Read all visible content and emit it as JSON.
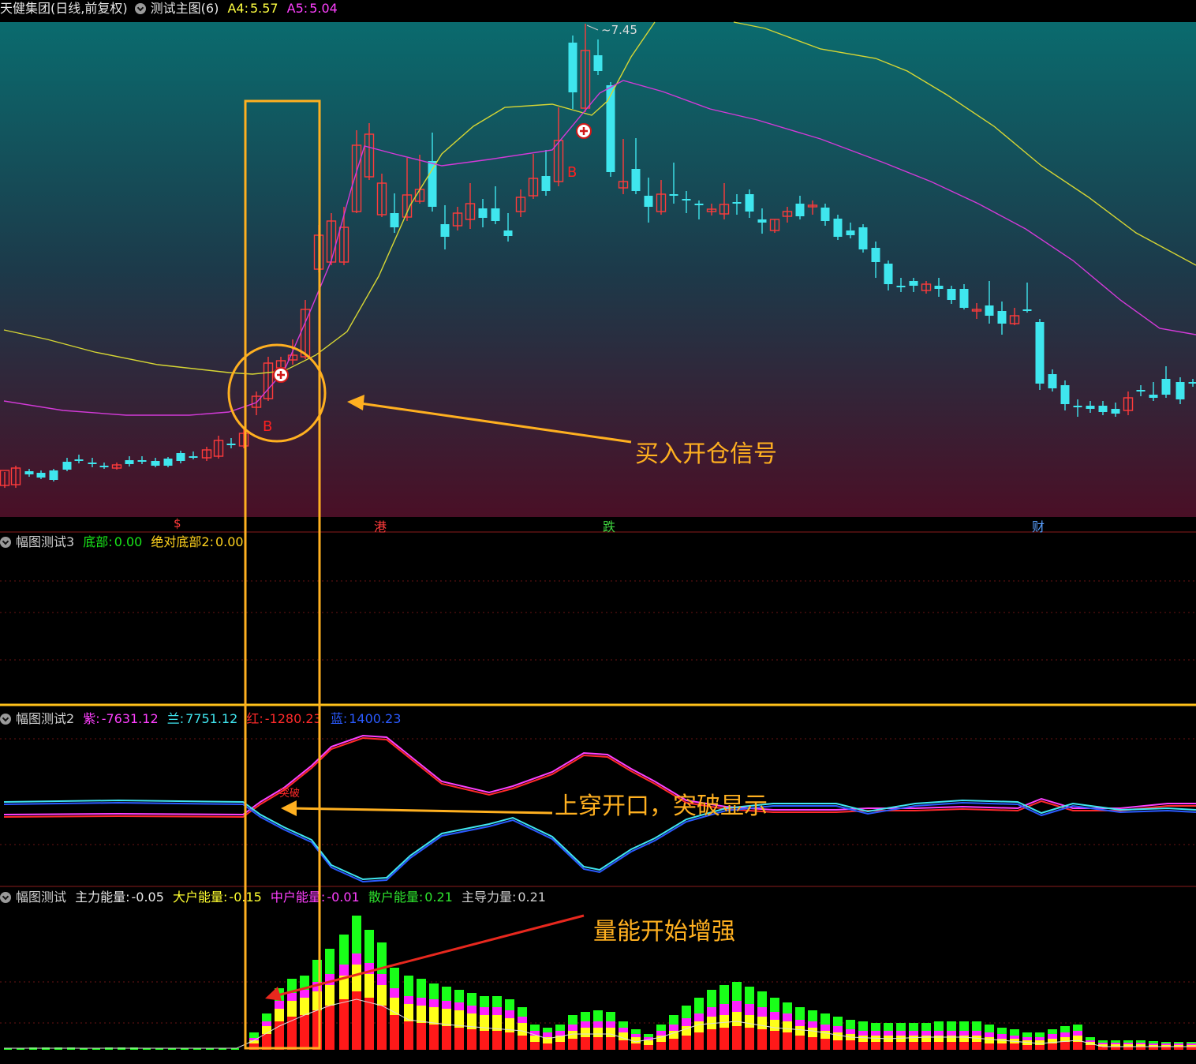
{
  "main_header": {
    "stock": "天健集团(日线,前复权)",
    "indicator": "测试主图(6)",
    "a4_label": "A4:",
    "a4_value": "5.57",
    "a5_label": "A5:",
    "a5_value": "5.04"
  },
  "peak_label": "7.45",
  "buy_marks": [
    "B",
    "B"
  ],
  "event_markers": [
    "$",
    "港",
    "跌",
    "财"
  ],
  "panel3_header": {
    "name": "幅图测试3",
    "bottom_label": "底部:",
    "bottom_value": "0.00",
    "abs_bottom_label": "绝对底部2:",
    "abs_bottom_value": "0.00"
  },
  "panel2_header": {
    "name": "幅图测试2",
    "purple_label": "紫:",
    "purple_value": "-7631.12",
    "cyan_label": "兰:",
    "cyan_value": "7751.12",
    "red_label": "红:",
    "red_value": "-1280.23",
    "blue_label": "蓝:",
    "blue_value": "1400.23"
  },
  "panel2_breakout_text": "突破",
  "panel1_header": {
    "name": "幅图测试",
    "main_label": "主力能量:",
    "main_value": "-0.05",
    "big_label": "大户能量:",
    "big_value": "-0.15",
    "mid_label": "中户能量:",
    "mid_value": "-0.01",
    "retail_label": "散户能量:",
    "retail_value": "0.21",
    "lead_label": "主导力量:",
    "lead_value": "0.21"
  },
  "annotations": {
    "buy_signal": "买入开仓信号",
    "cross_open": "上穿开口，突破显示",
    "volume_up": "量能开始增强"
  },
  "colors": {
    "up": "#ff3b3b",
    "down": "#3fe6ee",
    "yellow_line": "#d6d634",
    "magenta_line": "#d33ad8",
    "annotation": "#ffb020",
    "bar_green": "#19ff19",
    "bar_magenta": "#ff22ff",
    "bar_yellow": "#ffff19",
    "bar_red": "#ff1919"
  },
  "chart_data": [
    {
      "type": "candlestick",
      "title": "天健集团(日线,前复权)",
      "series": [
        {
          "name": "A4",
          "values": [
            5.57
          ]
        },
        {
          "name": "A5",
          "values": [
            5.04
          ]
        }
      ],
      "annotations": [
        "7.45",
        "B",
        "B"
      ]
    },
    {
      "type": "line",
      "title": "幅图测试3",
      "series": [
        {
          "name": "底部",
          "values": [
            0.0
          ]
        },
        {
          "name": "绝对底部2",
          "values": [
            0.0
          ]
        }
      ]
    },
    {
      "type": "line",
      "title": "幅图测试2",
      "series": [
        {
          "name": "紫",
          "values": [
            -7631.12
          ]
        },
        {
          "name": "兰",
          "values": [
            7751.12
          ]
        },
        {
          "name": "红",
          "values": [
            -1280.23
          ]
        },
        {
          "name": "蓝",
          "values": [
            1400.23
          ]
        }
      ]
    },
    {
      "type": "bar",
      "title": "幅图测试",
      "series": [
        {
          "name": "主力能量",
          "values": [
            -0.05
          ]
        },
        {
          "name": "大户能量",
          "values": [
            -0.15
          ]
        },
        {
          "name": "中户能量",
          "values": [
            -0.01
          ]
        },
        {
          "name": "散户能量",
          "values": [
            0.21
          ]
        },
        {
          "name": "主导力量",
          "values": [
            0.21
          ]
        }
      ]
    }
  ]
}
